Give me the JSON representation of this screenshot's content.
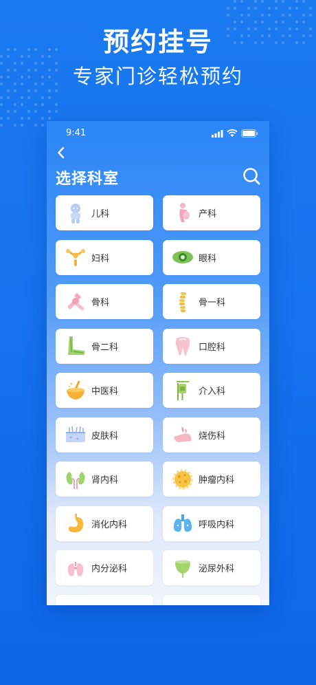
{
  "promo": {
    "headline": "预约挂号",
    "subline": "专家门诊轻松预约"
  },
  "status_bar": {
    "time": "9:41",
    "icons": [
      "signal-icon",
      "wifi-icon",
      "battery-icon"
    ]
  },
  "nav": {
    "back_icon": "chevron-left-icon",
    "title": "选择科室",
    "search_icon": "search-icon"
  },
  "departments": [
    {
      "label": "儿科",
      "icon": "baby-icon"
    },
    {
      "label": "产科",
      "icon": "pregnancy-icon"
    },
    {
      "label": "妇科",
      "icon": "uterus-icon"
    },
    {
      "label": "眼科",
      "icon": "eye-icon"
    },
    {
      "label": "骨科",
      "icon": "joint-icon"
    },
    {
      "label": "骨一科",
      "icon": "spine-icon"
    },
    {
      "label": "骨二科",
      "icon": "foot-bone-icon"
    },
    {
      "label": "口腔科",
      "icon": "tooth-icon"
    },
    {
      "label": "中医科",
      "icon": "mortar-icon"
    },
    {
      "label": "介入科",
      "icon": "iv-drip-icon"
    },
    {
      "label": "皮肤科",
      "icon": "skin-icon"
    },
    {
      "label": "烧伤科",
      "icon": "burn-hand-icon"
    },
    {
      "label": "肾内科",
      "icon": "kidney-icon"
    },
    {
      "label": "肿瘤内科",
      "icon": "tumor-icon"
    },
    {
      "label": "消化内科",
      "icon": "stomach-icon"
    },
    {
      "label": "呼吸内科",
      "icon": "lungs-icon"
    },
    {
      "label": "内分泌科",
      "icon": "thyroid-icon"
    },
    {
      "label": "泌尿外科",
      "icon": "bladder-icon"
    }
  ],
  "colors": {
    "background": "#1573ef",
    "card": "#ffffff",
    "text": "#333333"
  }
}
